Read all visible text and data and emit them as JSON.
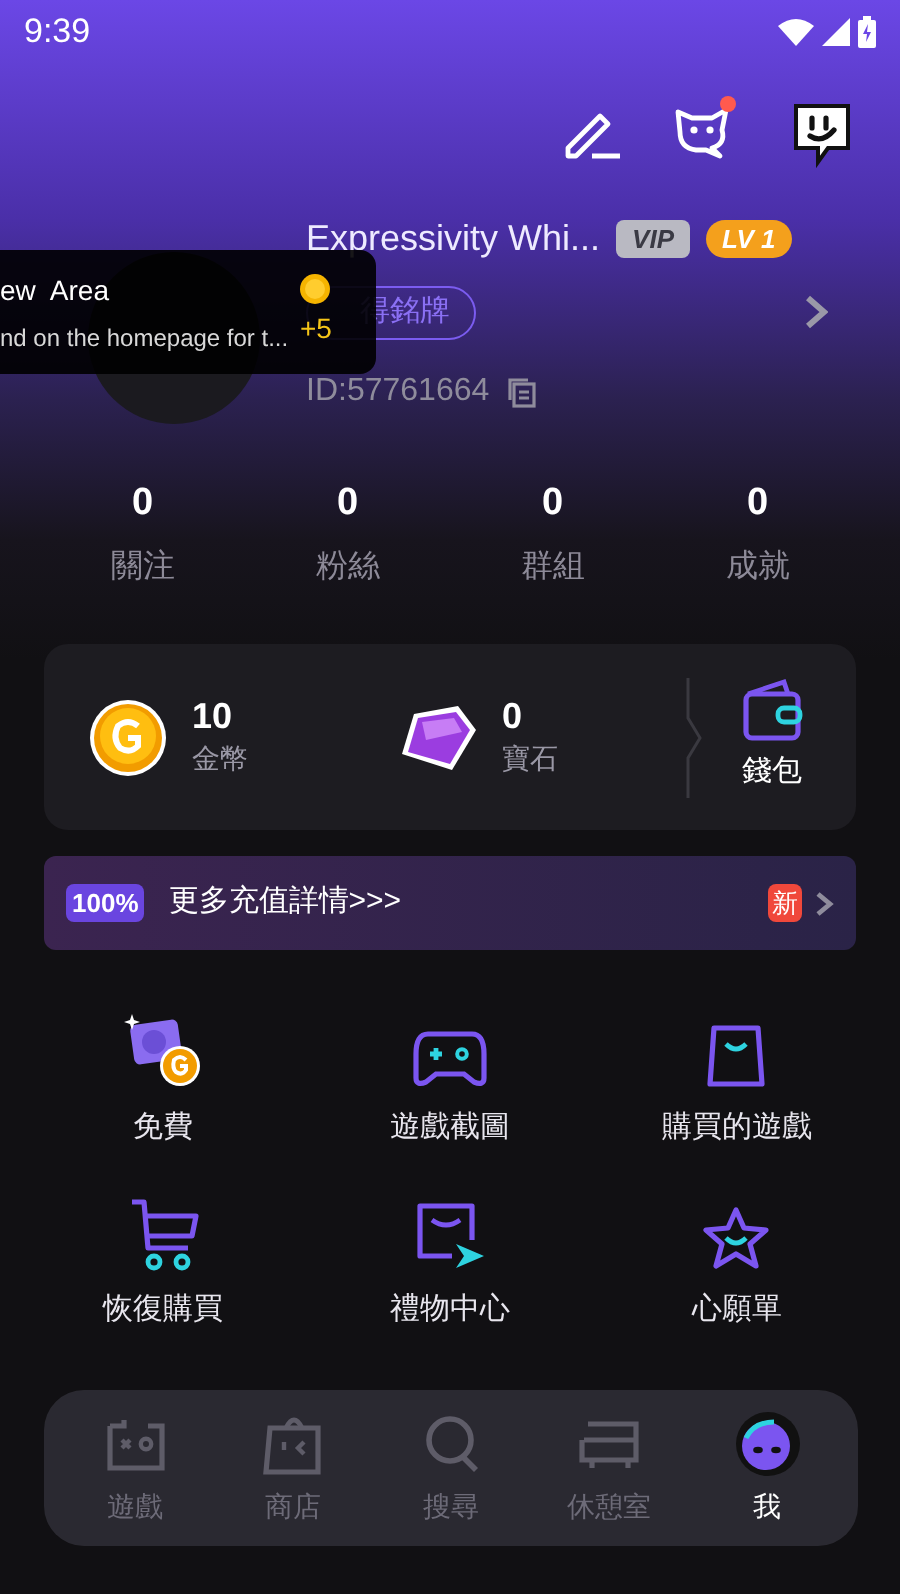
{
  "status_bar": {
    "time": "9:39"
  },
  "toast": {
    "title": "ew  Area",
    "message": "nd on the homepage for t...",
    "reward": "+5"
  },
  "profile": {
    "name": "Expressivity Whi...",
    "vip": "VIP",
    "level": "LV 1",
    "badge": "得銘牌",
    "id": "ID:57761664",
    "notification": true
  },
  "stats": [
    {
      "value": "0",
      "label": "關注"
    },
    {
      "value": "0",
      "label": "粉絲"
    },
    {
      "value": "0",
      "label": "群組"
    },
    {
      "value": "0",
      "label": "成就"
    }
  ],
  "wallet": {
    "coins": {
      "value": "10",
      "label": "金幣"
    },
    "gems": {
      "value": "0",
      "label": "寶石"
    },
    "wallet_label": "錢包"
  },
  "promo": {
    "tag": "100%",
    "text": "更多充值詳情>>>",
    "badge": "新"
  },
  "features": [
    {
      "kind": "free",
      "label": "免費"
    },
    {
      "kind": "gamepad",
      "label": "遊戲截圖"
    },
    {
      "kind": "bag",
      "label": "購買的遊戲"
    },
    {
      "kind": "cart",
      "label": "恢復購買"
    },
    {
      "kind": "gift",
      "label": "禮物中心"
    },
    {
      "kind": "star",
      "label": "心願單"
    }
  ],
  "nav": [
    {
      "kind": "games",
      "label": "遊戲",
      "selected": false
    },
    {
      "kind": "store",
      "label": "商店",
      "selected": false
    },
    {
      "kind": "search",
      "label": "搜尋",
      "selected": false
    },
    {
      "kind": "lounge",
      "label": "休憩室",
      "selected": false
    },
    {
      "kind": "me",
      "label": "我",
      "selected": true
    }
  ]
}
